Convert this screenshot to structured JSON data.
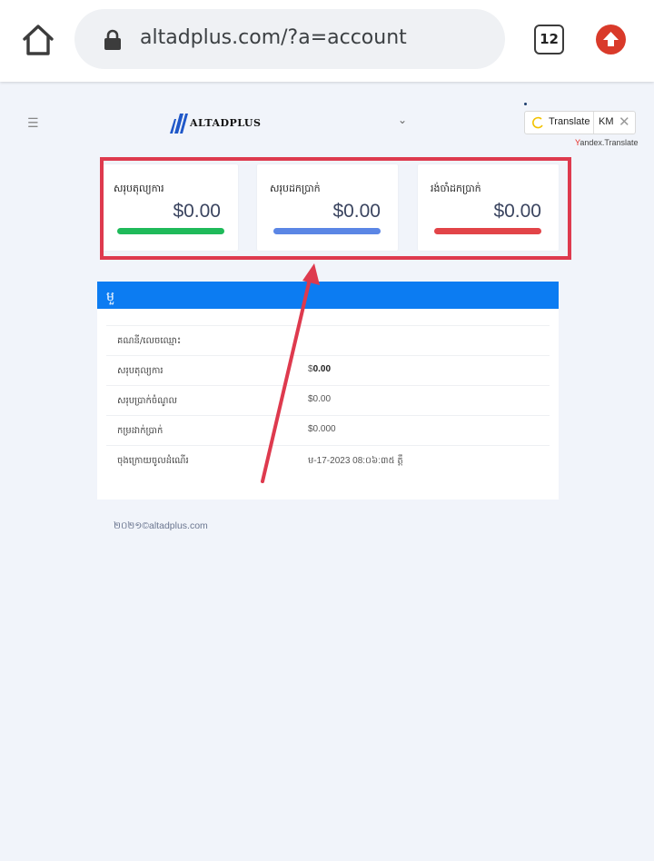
{
  "browser": {
    "url": "altadplus.com/?a=account",
    "tab_count": "12"
  },
  "header": {
    "logo_text": "ALTADPLUS",
    "translate_label": "Translate",
    "translate_lang": "KM",
    "yandex_y": "Y",
    "yandex_rest": "andex.Translate"
  },
  "cards": [
    {
      "title": "សរុបតុល្យការ",
      "value": "$0.00",
      "color": "#1fba5a"
    },
    {
      "title": "សរុបដកប្រាក់",
      "value": "$0.00",
      "color": "#5b86e5"
    },
    {
      "title": "រង់ចាំដកប្រាក់",
      "value": "$0.00",
      "color": "#e24448"
    }
  ],
  "panel": {
    "header": "មួ",
    "rows": [
      {
        "label": "គណនី/លេចឈ្មោះ",
        "value": ""
      },
      {
        "label": "សរុបតុល្យការ",
        "value_prefix": "$",
        "value_bold": "0.00"
      },
      {
        "label": "សរុបប្រាក់ចំណូល",
        "value": "$0.00"
      },
      {
        "label": "កម្រដាក់ប្រាក់",
        "value": "$0.000"
      },
      {
        "label": "ចុងក្រោយចូលដំណើរ",
        "value": "ម-17-2023 08:០៦:៣៥ ត្តឹ"
      }
    ]
  },
  "footer": {
    "text": "២០២១©altadplus.com"
  },
  "annotation": {
    "highlight_color": "#de3a4e"
  }
}
